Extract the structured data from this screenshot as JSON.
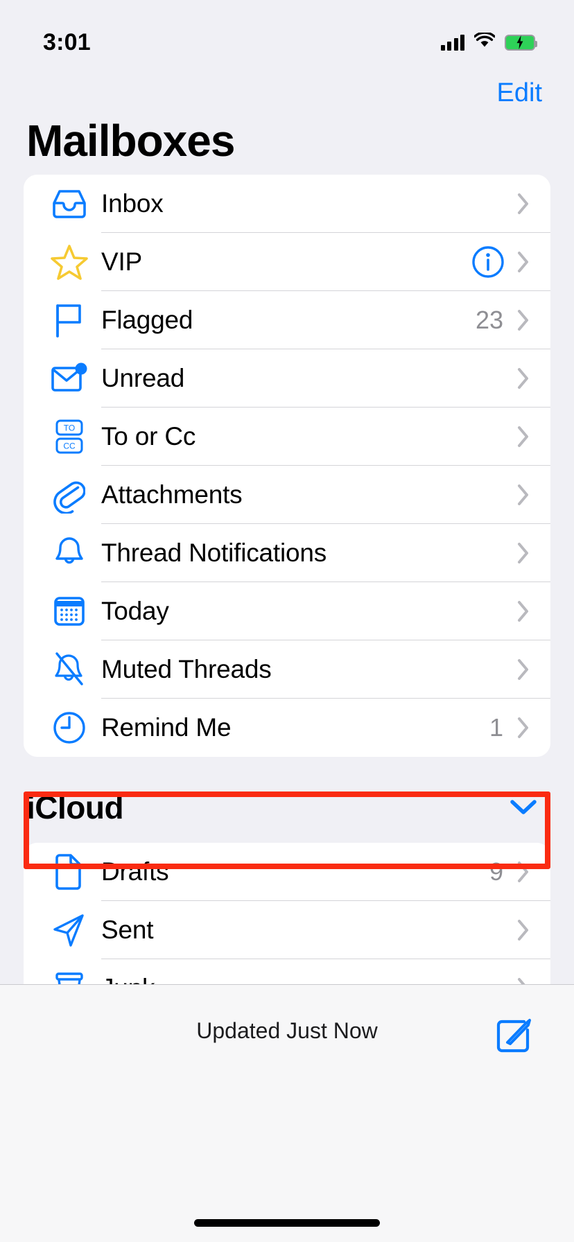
{
  "status_bar": {
    "time": "3:01",
    "signal_icon": "cellular-bars-icon",
    "wifi_icon": "wifi-icon",
    "battery_icon": "battery-charging-icon",
    "battery_color": "#2ed158"
  },
  "nav": {
    "edit_label": "Edit"
  },
  "header": {
    "title": "Mailboxes"
  },
  "accent_color": "#0a7cff",
  "highlight_color": "#fa2b11",
  "mailboxes": {
    "items": [
      {
        "label": "Inbox",
        "icon": "inbox-tray-icon",
        "count": "",
        "has_info": false
      },
      {
        "label": "VIP",
        "icon": "star-icon",
        "count": "",
        "has_info": true
      },
      {
        "label": "Flagged",
        "icon": "flag-icon",
        "count": "23",
        "has_info": false
      },
      {
        "label": "Unread",
        "icon": "unread-envelope-icon",
        "count": "",
        "has_info": false
      },
      {
        "label": "To or Cc",
        "icon": "to-cc-icon",
        "count": "",
        "has_info": false
      },
      {
        "label": "Attachments",
        "icon": "paperclip-icon",
        "count": "",
        "has_info": false
      },
      {
        "label": "Thread Notifications",
        "icon": "bell-icon",
        "count": "",
        "has_info": false
      },
      {
        "label": "Today",
        "icon": "calendar-icon",
        "count": "",
        "has_info": false
      },
      {
        "label": "Muted Threads",
        "icon": "bell-slash-icon",
        "count": "",
        "has_info": false
      },
      {
        "label": "Remind Me",
        "icon": "clock-icon",
        "count": "1",
        "has_info": false
      }
    ]
  },
  "icloud_section": {
    "title": "iCloud",
    "collapse_icon": "chevron-down-icon",
    "items": [
      {
        "label": "Drafts",
        "icon": "document-icon",
        "count": "9"
      },
      {
        "label": "Sent",
        "icon": "paper-plane-icon",
        "count": ""
      },
      {
        "label": "Junk",
        "icon": "trash-x-icon",
        "count": ""
      }
    ]
  },
  "toolbar": {
    "status_text": "Updated Just Now",
    "compose_icon": "compose-pencil-icon"
  }
}
